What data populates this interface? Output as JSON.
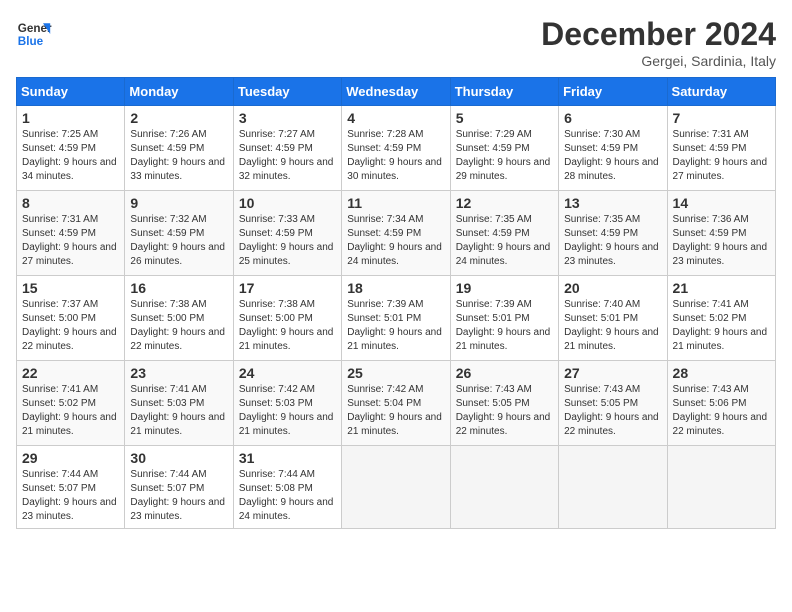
{
  "header": {
    "logo_line1": "General",
    "logo_line2": "Blue",
    "month_title": "December 2024",
    "subtitle": "Gergei, Sardinia, Italy"
  },
  "days_of_week": [
    "Sunday",
    "Monday",
    "Tuesday",
    "Wednesday",
    "Thursday",
    "Friday",
    "Saturday"
  ],
  "weeks": [
    [
      {
        "day": "1",
        "sunrise": "7:25 AM",
        "sunset": "4:59 PM",
        "daylight": "9 hours and 34 minutes."
      },
      {
        "day": "2",
        "sunrise": "7:26 AM",
        "sunset": "4:59 PM",
        "daylight": "9 hours and 33 minutes."
      },
      {
        "day": "3",
        "sunrise": "7:27 AM",
        "sunset": "4:59 PM",
        "daylight": "9 hours and 32 minutes."
      },
      {
        "day": "4",
        "sunrise": "7:28 AM",
        "sunset": "4:59 PM",
        "daylight": "9 hours and 30 minutes."
      },
      {
        "day": "5",
        "sunrise": "7:29 AM",
        "sunset": "4:59 PM",
        "daylight": "9 hours and 29 minutes."
      },
      {
        "day": "6",
        "sunrise": "7:30 AM",
        "sunset": "4:59 PM",
        "daylight": "9 hours and 28 minutes."
      },
      {
        "day": "7",
        "sunrise": "7:31 AM",
        "sunset": "4:59 PM",
        "daylight": "9 hours and 27 minutes."
      }
    ],
    [
      {
        "day": "8",
        "sunrise": "7:31 AM",
        "sunset": "4:59 PM",
        "daylight": "9 hours and 27 minutes."
      },
      {
        "day": "9",
        "sunrise": "7:32 AM",
        "sunset": "4:59 PM",
        "daylight": "9 hours and 26 minutes."
      },
      {
        "day": "10",
        "sunrise": "7:33 AM",
        "sunset": "4:59 PM",
        "daylight": "9 hours and 25 minutes."
      },
      {
        "day": "11",
        "sunrise": "7:34 AM",
        "sunset": "4:59 PM",
        "daylight": "9 hours and 24 minutes."
      },
      {
        "day": "12",
        "sunrise": "7:35 AM",
        "sunset": "4:59 PM",
        "daylight": "9 hours and 24 minutes."
      },
      {
        "day": "13",
        "sunrise": "7:35 AM",
        "sunset": "4:59 PM",
        "daylight": "9 hours and 23 minutes."
      },
      {
        "day": "14",
        "sunrise": "7:36 AM",
        "sunset": "4:59 PM",
        "daylight": "9 hours and 23 minutes."
      }
    ],
    [
      {
        "day": "15",
        "sunrise": "7:37 AM",
        "sunset": "5:00 PM",
        "daylight": "9 hours and 22 minutes."
      },
      {
        "day": "16",
        "sunrise": "7:38 AM",
        "sunset": "5:00 PM",
        "daylight": "9 hours and 22 minutes."
      },
      {
        "day": "17",
        "sunrise": "7:38 AM",
        "sunset": "5:00 PM",
        "daylight": "9 hours and 21 minutes."
      },
      {
        "day": "18",
        "sunrise": "7:39 AM",
        "sunset": "5:01 PM",
        "daylight": "9 hours and 21 minutes."
      },
      {
        "day": "19",
        "sunrise": "7:39 AM",
        "sunset": "5:01 PM",
        "daylight": "9 hours and 21 minutes."
      },
      {
        "day": "20",
        "sunrise": "7:40 AM",
        "sunset": "5:01 PM",
        "daylight": "9 hours and 21 minutes."
      },
      {
        "day": "21",
        "sunrise": "7:41 AM",
        "sunset": "5:02 PM",
        "daylight": "9 hours and 21 minutes."
      }
    ],
    [
      {
        "day": "22",
        "sunrise": "7:41 AM",
        "sunset": "5:02 PM",
        "daylight": "9 hours and 21 minutes."
      },
      {
        "day": "23",
        "sunrise": "7:41 AM",
        "sunset": "5:03 PM",
        "daylight": "9 hours and 21 minutes."
      },
      {
        "day": "24",
        "sunrise": "7:42 AM",
        "sunset": "5:03 PM",
        "daylight": "9 hours and 21 minutes."
      },
      {
        "day": "25",
        "sunrise": "7:42 AM",
        "sunset": "5:04 PM",
        "daylight": "9 hours and 21 minutes."
      },
      {
        "day": "26",
        "sunrise": "7:43 AM",
        "sunset": "5:05 PM",
        "daylight": "9 hours and 22 minutes."
      },
      {
        "day": "27",
        "sunrise": "7:43 AM",
        "sunset": "5:05 PM",
        "daylight": "9 hours and 22 minutes."
      },
      {
        "day": "28",
        "sunrise": "7:43 AM",
        "sunset": "5:06 PM",
        "daylight": "9 hours and 22 minutes."
      }
    ],
    [
      {
        "day": "29",
        "sunrise": "7:44 AM",
        "sunset": "5:07 PM",
        "daylight": "9 hours and 23 minutes."
      },
      {
        "day": "30",
        "sunrise": "7:44 AM",
        "sunset": "5:07 PM",
        "daylight": "9 hours and 23 minutes."
      },
      {
        "day": "31",
        "sunrise": "7:44 AM",
        "sunset": "5:08 PM",
        "daylight": "9 hours and 24 minutes."
      },
      null,
      null,
      null,
      null
    ]
  ]
}
